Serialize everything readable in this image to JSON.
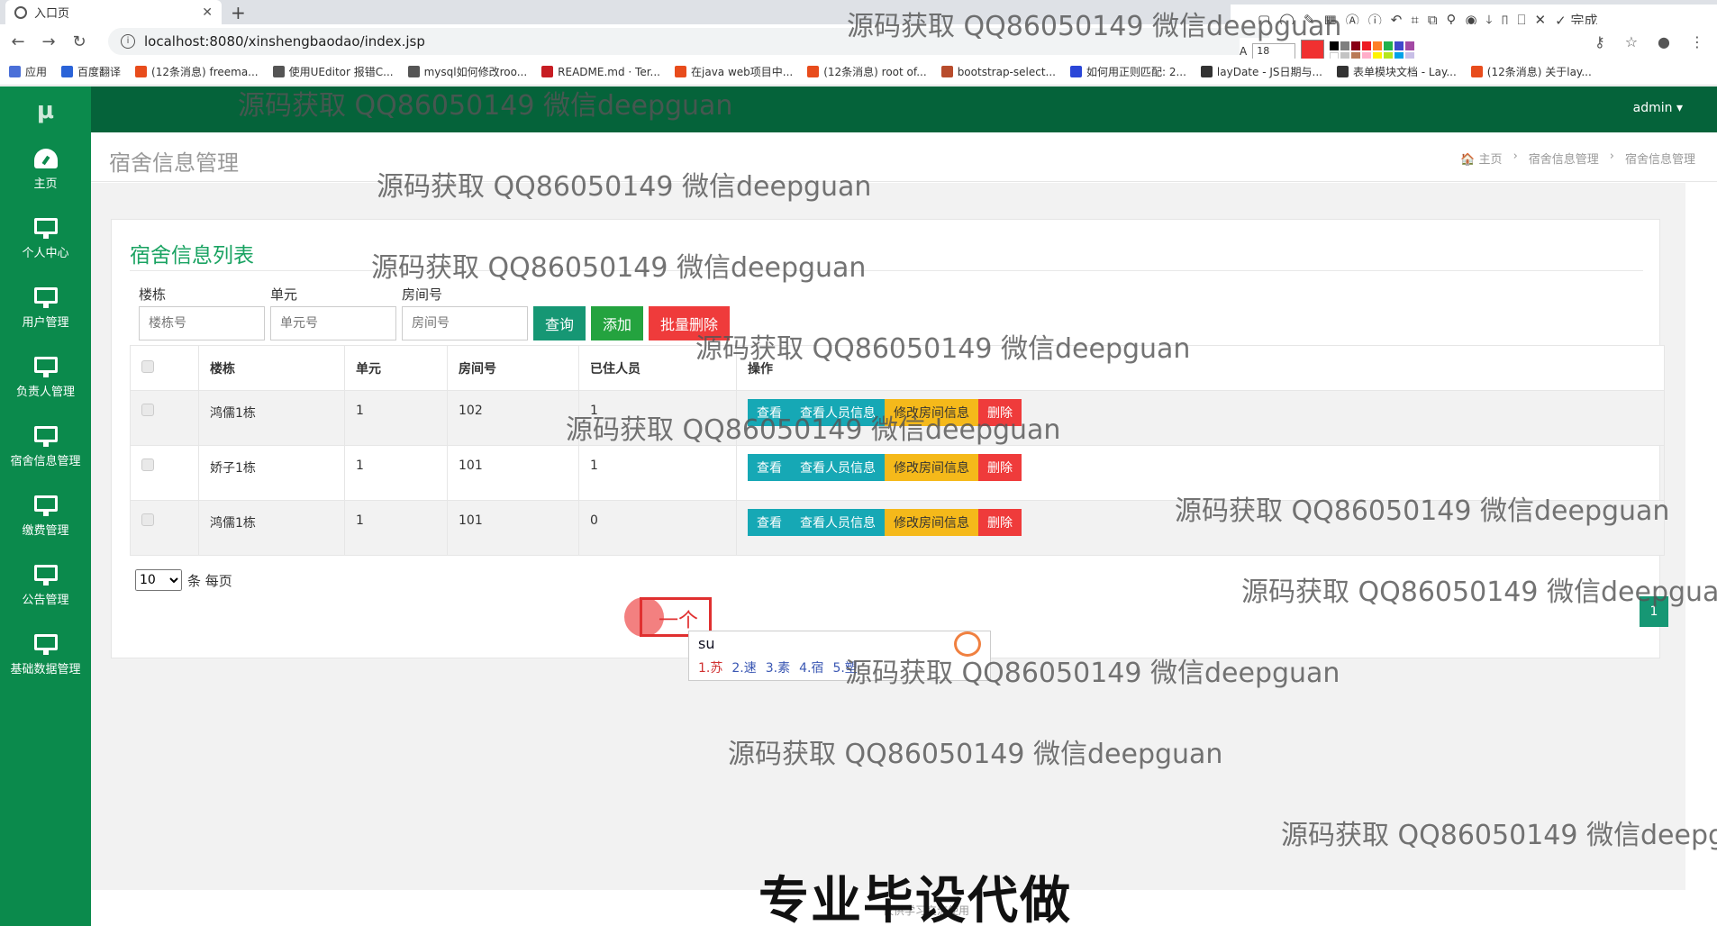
{
  "browser": {
    "tab_title": "入口页",
    "url": "localhost:8080/xinshengbaodao/index.jsp",
    "bookmarks": [
      {
        "label": "应用",
        "color": "#4a6fd8"
      },
      {
        "label": "百度翻译",
        "color": "#2a63d8"
      },
      {
        "label": "(12条消息) freema...",
        "color": "#e84c1c"
      },
      {
        "label": "使用UEditor 报错C...",
        "color": "#555555"
      },
      {
        "label": "mysql如何修改roo...",
        "color": "#555555"
      },
      {
        "label": "README.md · Ter...",
        "color": "#c71d23"
      },
      {
        "label": "在java web项目中...",
        "color": "#e84c1c"
      },
      {
        "label": "(12条消息) root of...",
        "color": "#e84c1c"
      },
      {
        "label": "bootstrap-select...",
        "color": "#b84c2c"
      },
      {
        "label": "如何用正则匹配: 2...",
        "color": "#2a46d8"
      },
      {
        "label": "layDate - JS日期与...",
        "color": "#333333"
      },
      {
        "label": "表单模块文档 - Lay...",
        "color": "#333333"
      },
      {
        "label": "(12条消息) 关于lay...",
        "color": "#e84c1c"
      }
    ],
    "annot_right_label": "完成",
    "font_size_value": "18"
  },
  "sidebar": {
    "logo": "μ",
    "items": [
      {
        "label": "主页",
        "icon": "dashboard-icon"
      },
      {
        "label": "个人中心",
        "icon": "monitor-icon"
      },
      {
        "label": "用户管理",
        "icon": "monitor-icon"
      },
      {
        "label": "负责人管理",
        "icon": "monitor-icon"
      },
      {
        "label": "宿舍信息管理",
        "icon": "monitor-icon"
      },
      {
        "label": "缴费管理",
        "icon": "monitor-icon"
      },
      {
        "label": "公告管理",
        "icon": "monitor-icon"
      },
      {
        "label": "基础数据管理",
        "icon": "monitor-icon"
      }
    ]
  },
  "header": {
    "user": "admin ▾",
    "page_title": "宿舍信息管理",
    "breadcrumb": [
      "🏠 主页",
      "›",
      "宿舍信息管理",
      "›",
      "宿舍信息管理"
    ]
  },
  "list": {
    "title": "宿舍信息列表",
    "search": {
      "building_label": "楼栋",
      "building_placeholder": "楼栋号",
      "unit_label": "单元",
      "unit_placeholder": "单元号",
      "room_label": "房间号",
      "room_placeholder": "房间号",
      "query": "查询",
      "add": "添加",
      "batch_delete": "批量删除"
    },
    "columns": [
      "楼栋",
      "单元",
      "房间号",
      "已住人员",
      "操作"
    ],
    "rows": [
      {
        "building": "鸿儒1栋",
        "unit": "1",
        "room": "102",
        "occupants": "1"
      },
      {
        "building": "娇子1栋",
        "unit": "1",
        "room": "101",
        "occupants": "1"
      },
      {
        "building": "鸿儒1栋",
        "unit": "1",
        "room": "101",
        "occupants": "0"
      }
    ],
    "actions": {
      "view": "查看",
      "people": "查看人员信息",
      "edit": "修改房间信息",
      "delete": "删除"
    },
    "page_size": "10",
    "page_size_suffix": "条 每页",
    "current_page": "1"
  },
  "overlay": {
    "marker_text": "一个",
    "ime_input": "su",
    "ime_candidates": [
      "1.苏",
      "2.速",
      "3.素",
      "4.宿",
      "5.塑"
    ],
    "footer_text": "仅供学习交流使用",
    "banner": "专业毕设代做",
    "watermark": "源码获取 QQ86050149 微信deepguan"
  }
}
